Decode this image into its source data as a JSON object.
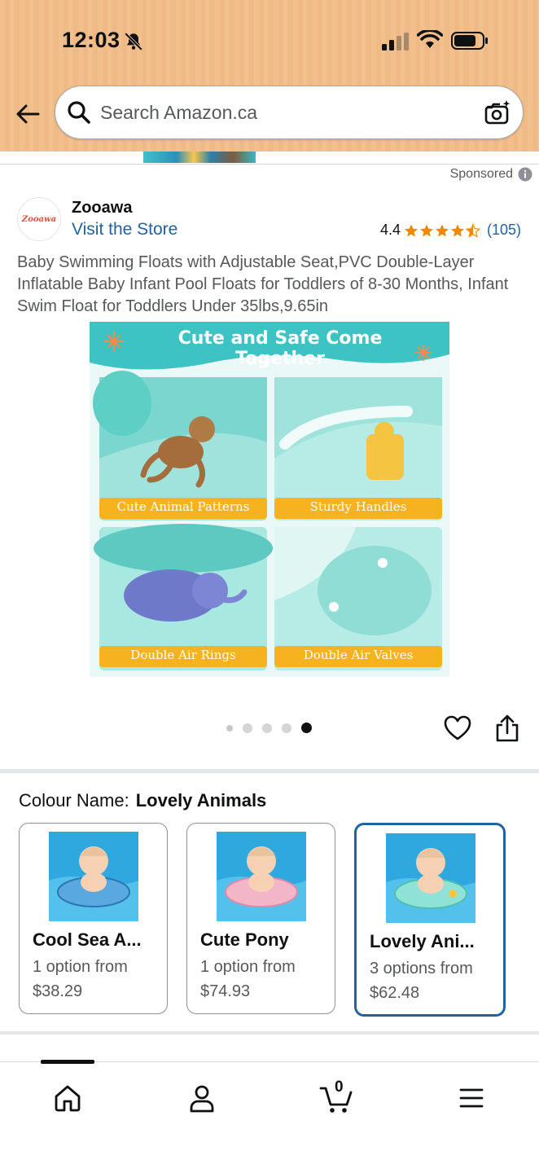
{
  "status_bar": {
    "time": "12:03"
  },
  "search": {
    "placeholder": "Search Amazon.ca"
  },
  "sponsored_label": "Sponsored",
  "brand": {
    "logo_text": "Zooawa",
    "name": "Zooawa",
    "visit_store_label": "Visit the Store"
  },
  "rating": {
    "value": "4.4",
    "stars": 4.4,
    "count": "(105)"
  },
  "product_title": "Baby Swimming Floats with Adjustable Seat,PVC Double-Layer Inflatable Baby Infant Pool Floats for Toddlers of 8-30 Months, Infant Swim Float for Toddlers Under 35lbs,9.65in",
  "product_image": {
    "banner": "Cute and Safe Come Together",
    "features": [
      "Cute Animal Patterns",
      "Sturdy Handles",
      "Double Air Rings",
      "Double Air Valves"
    ]
  },
  "carousel": {
    "total": 5,
    "active_index": 4
  },
  "colour": {
    "label": "Colour Name:",
    "selected_value": "Lovely Animals",
    "options": [
      {
        "name": "Cool Sea A...",
        "options_text": "1 option from",
        "price": "$38.29",
        "ring_color": "#5aa8e0",
        "selected": false
      },
      {
        "name": "Cute Pony",
        "options_text": "1 option from",
        "price": "$74.93",
        "ring_color": "#f2b6c8",
        "selected": false
      },
      {
        "name": "Lovely Ani...",
        "options_text": "3 options from",
        "price": "$62.48",
        "ring_color": "#8fe3d6",
        "selected": true
      }
    ]
  },
  "bottom_nav": {
    "items": [
      "home-icon",
      "account-icon",
      "cart-icon",
      "menu-icon"
    ],
    "cart_count": "0"
  },
  "colors": {
    "link": "#2162a1",
    "star": "#f08804",
    "header": "#f2c08d",
    "selected_border": "#2162a1"
  }
}
